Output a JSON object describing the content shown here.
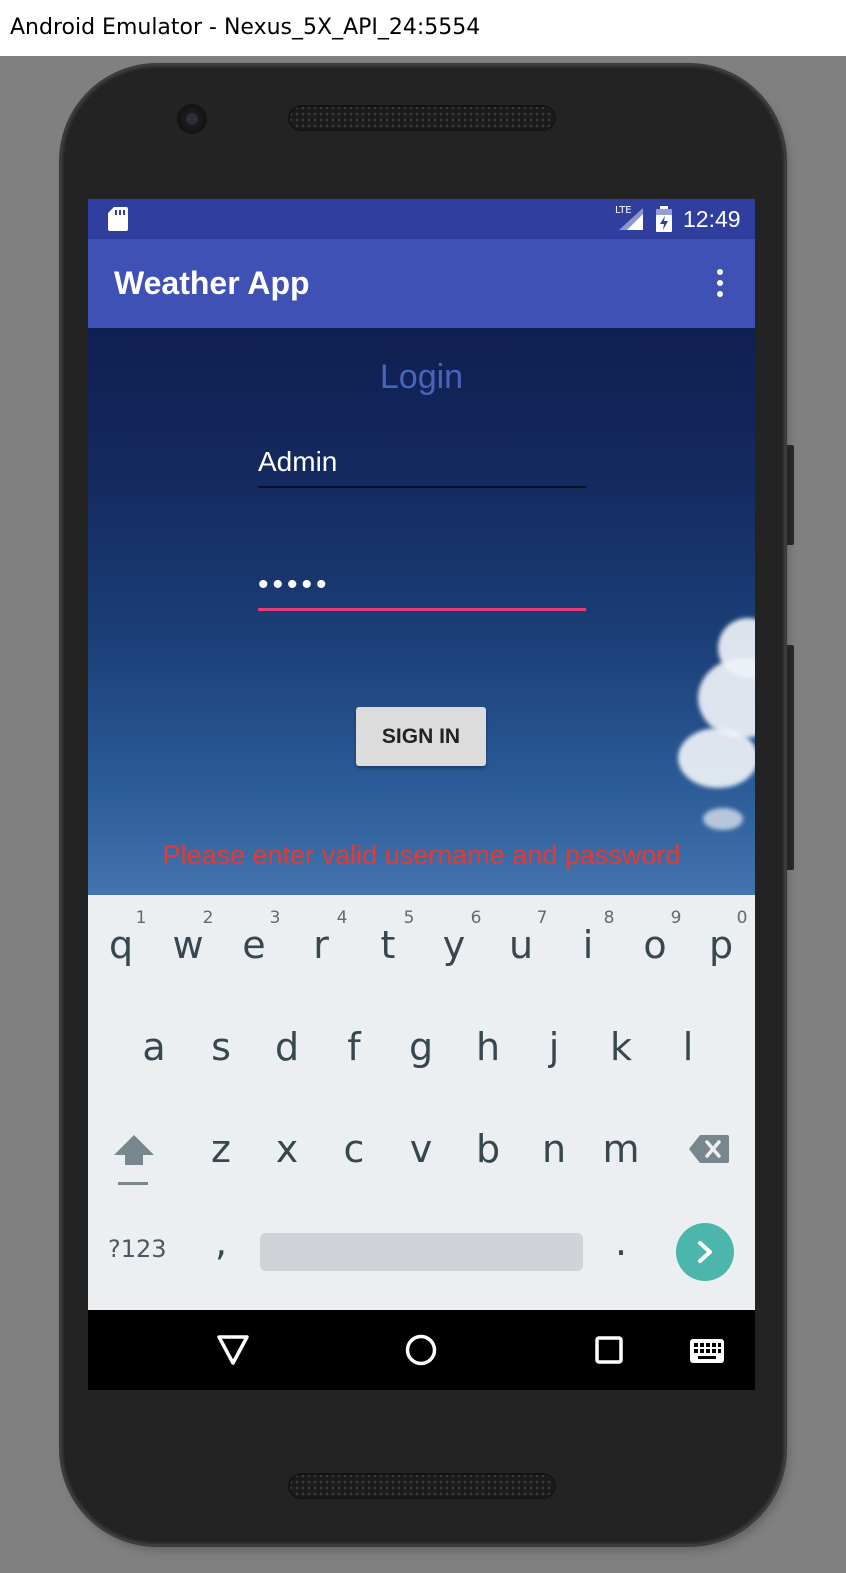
{
  "window": {
    "title": "Android Emulator - Nexus_5X_API_24:5554"
  },
  "status_bar": {
    "time": "12:49",
    "network": "LTE"
  },
  "app_bar": {
    "title": "Weather App"
  },
  "login": {
    "heading": "Login",
    "username_value": "Admin",
    "password_value": "•••••",
    "sign_in_label": "SIGN IN",
    "error_message": "Please enter valid username and password"
  },
  "keyboard": {
    "row1": [
      "q",
      "w",
      "e",
      "r",
      "t",
      "y",
      "u",
      "i",
      "o",
      "p"
    ],
    "row1_hints": [
      "1",
      "2",
      "3",
      "4",
      "5",
      "6",
      "7",
      "8",
      "9",
      "0"
    ],
    "row2": [
      "a",
      "s",
      "d",
      "f",
      "g",
      "h",
      "j",
      "k",
      "l"
    ],
    "row3": [
      "z",
      "x",
      "c",
      "v",
      "b",
      "n",
      "m"
    ],
    "symbols_label": "?123",
    "comma": ",",
    "period": "."
  },
  "colors": {
    "status_bar": "#303f9f",
    "app_bar": "#3f51b5",
    "error": "#e8392f",
    "password_underline": "#e63d7a",
    "enter_key": "#4db6ac"
  }
}
